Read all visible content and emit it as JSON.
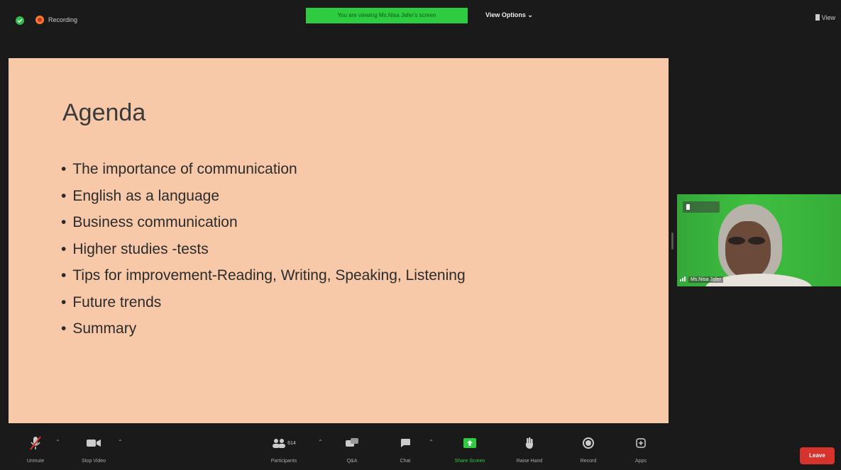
{
  "topbar": {
    "recording_label": "Recording",
    "viewing_banner": "You are viewing Ms.Nisa Jafer's screen",
    "view_options": "View Options",
    "view_label": "View"
  },
  "slide": {
    "title": "Agenda",
    "bullets": [
      "The importance of communication",
      "English as a language",
      "Business communication",
      "Higher studies -tests",
      "Tips for improvement-Reading, Writing, Speaking, Listening",
      "Future trends",
      "Summary"
    ]
  },
  "video": {
    "name": "Ms.Nisa Jafer"
  },
  "toolbar": {
    "unmute": "Unmute",
    "stop_video": "Stop Video",
    "participants": "Participants",
    "participants_count": "614",
    "qa": "Q&A",
    "chat": "Chat",
    "share_screen": "Share Screen",
    "raise_hand": "Raise Hand",
    "record": "Record",
    "apps": "Apps",
    "leave": "Leave"
  },
  "colors": {
    "slide_bg": "#f8c9a9",
    "banner_green": "#2ecc40",
    "leave_red": "#d6332c",
    "share_green": "#2ecc40"
  },
  "icons": [
    "shield-icon",
    "recording-icon",
    "view-icon",
    "microphone-muted-icon",
    "video-camera-icon",
    "participants-icon",
    "qa-icon",
    "chat-icon",
    "share-screen-icon",
    "raise-hand-icon",
    "record-icon",
    "apps-icon",
    "caret-up-icon"
  ]
}
